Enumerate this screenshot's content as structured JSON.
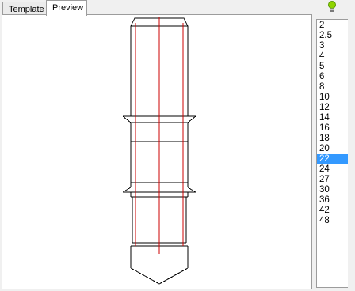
{
  "tabs": [
    {
      "label": "Template",
      "selected": false
    },
    {
      "label": "Preview",
      "selected": true
    }
  ],
  "hint_icon": {
    "name": "lightbulb-icon",
    "color": "#8fd400"
  },
  "sizes": {
    "items": [
      "2",
      "2.5",
      "3",
      "4",
      "5",
      "6",
      "8",
      "10",
      "12",
      "14",
      "16",
      "18",
      "20",
      "22",
      "24",
      "27",
      "30",
      "36",
      "42",
      "48"
    ],
    "selected": "22"
  },
  "colors": {
    "outline": "#000000",
    "centerline": "#cc0000",
    "selection": "#3399ff"
  }
}
